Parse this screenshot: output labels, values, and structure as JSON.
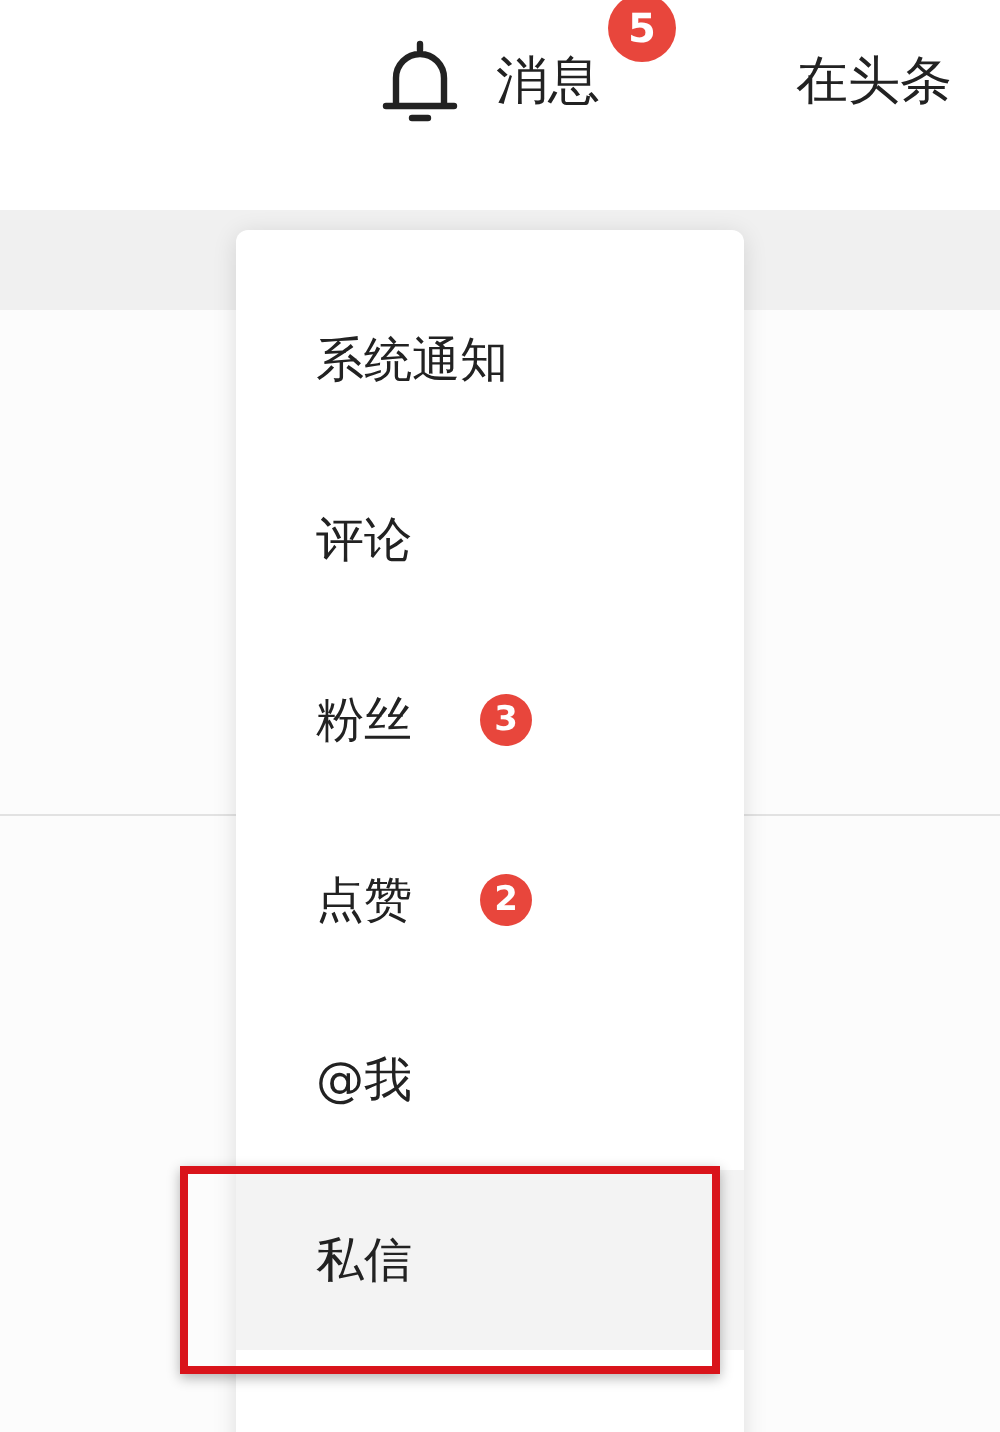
{
  "header": {
    "messages": {
      "label": "消息",
      "badge": "5"
    },
    "link": "在头条"
  },
  "menu": {
    "items": [
      {
        "label": "系统通知",
        "selected": false
      },
      {
        "label": "评论",
        "selected": false
      },
      {
        "label": "粉丝",
        "badge": "3",
        "selected": false
      },
      {
        "label": "点赞",
        "badge": "2",
        "selected": false
      },
      {
        "label": "@我",
        "selected": false
      },
      {
        "label": "私信",
        "selected": true
      }
    ]
  }
}
